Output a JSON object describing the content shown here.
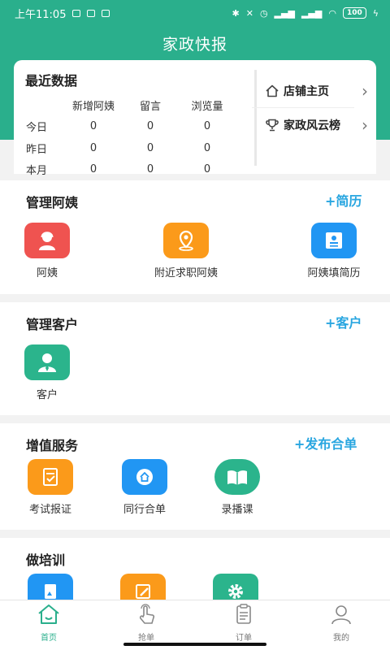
{
  "status_bar": {
    "time": "上午11:05",
    "battery": "100"
  },
  "app_title": "家政快报",
  "recent_data": {
    "title": "最近数据",
    "columns": [
      "",
      "新增阿姨",
      "留言",
      "浏览量"
    ],
    "rows": [
      {
        "label": "今日",
        "values": [
          "0",
          "0",
          "0"
        ]
      },
      {
        "label": "昨日",
        "values": [
          "0",
          "0",
          "0"
        ]
      },
      {
        "label": "本月",
        "values": [
          "0",
          "0",
          "0"
        ]
      }
    ],
    "links": [
      {
        "label": "店铺主页",
        "icon": "home-outline-icon"
      },
      {
        "label": "家政风云榜",
        "icon": "trophy-icon"
      }
    ]
  },
  "manage_aunties": {
    "title": "管理阿姨",
    "action": "+简历",
    "items": [
      {
        "label": "阿姨",
        "icon": "auntie-icon",
        "color": "#ef5350"
      },
      {
        "label": "附近求职阿姨",
        "icon": "location-pin-icon",
        "color": "#fb9a1a"
      },
      {
        "label": "阿姨填简历",
        "icon": "resume-card-icon",
        "color": "#2196f3"
      }
    ]
  },
  "manage_clients": {
    "title": "管理客户",
    "action": "+客户",
    "items": [
      {
        "label": "客户",
        "icon": "client-person-icon",
        "color": "#2bb48c"
      }
    ]
  },
  "value_added": {
    "title": "增值服务",
    "action": "+发布合单",
    "items": [
      {
        "label": "考试报证",
        "icon": "exam-icon",
        "color": "#fb9a1a"
      },
      {
        "label": "同行合单",
        "icon": "merge-order-icon",
        "color": "#2196f3"
      },
      {
        "label": "录播课",
        "icon": "open-book-icon",
        "color": "#2bb48c"
      }
    ]
  },
  "training": {
    "title": "做培训",
    "items": [
      {
        "icon": "image-doc-icon",
        "color": "#2196f3"
      },
      {
        "icon": "edit-pen-icon",
        "color": "#fb9a1a"
      },
      {
        "icon": "gear-icon",
        "color": "#2bb48c"
      }
    ]
  },
  "bottom_nav": [
    {
      "label": "首页",
      "icon": "home-icon",
      "active": true
    },
    {
      "label": "抢单",
      "icon": "tap-hand-icon",
      "active": false
    },
    {
      "label": "订单",
      "icon": "clipboard-icon",
      "active": false
    },
    {
      "label": "我的",
      "icon": "user-icon",
      "active": false
    }
  ],
  "colors": {
    "brand": "#2aaf8c",
    "action": "#29a6e0"
  }
}
